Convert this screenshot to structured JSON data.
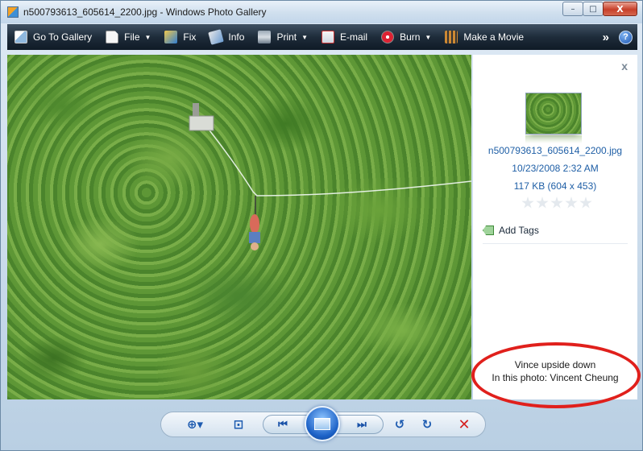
{
  "window": {
    "title": "n500793613_605614_2200.jpg - Windows Photo Gallery",
    "minimize": "–",
    "maximize": "□",
    "close": "X"
  },
  "toolbar": {
    "items": [
      {
        "label": "Go To Gallery",
        "icon": "gallery-icon"
      },
      {
        "label": "File",
        "icon": "file-icon",
        "dropdown": true
      },
      {
        "label": "Fix",
        "icon": "fix-icon"
      },
      {
        "label": "Info",
        "icon": "info-icon"
      },
      {
        "label": "Print",
        "icon": "print-icon",
        "dropdown": true
      },
      {
        "label": "E-mail",
        "icon": "email-icon"
      },
      {
        "label": "Burn",
        "icon": "burn-icon",
        "dropdown": true
      },
      {
        "label": "Make a Movie",
        "icon": "movie-icon"
      }
    ],
    "overflow": "»",
    "help": "?"
  },
  "info_pane": {
    "close": "x",
    "file_name": "n500793613_605614_2200.jpg",
    "date": "10/23/2008   2:32 AM",
    "size": "117 KB (604 x 453)",
    "rating": 0,
    "add_tags": "Add Tags",
    "caption_line1": "Vince upside down",
    "caption_line2": "In this photo: Vincent Cheung"
  },
  "controls": {
    "zoom": "⊕▾",
    "fit": "⊡",
    "prev": "⏮",
    "next": "⏭",
    "rotate_ccw": "↺",
    "rotate_cw": "↻",
    "delete": "✕"
  },
  "colors": {
    "toolbar_bg": "#1e2c3a",
    "link_blue": "#1f5fa6",
    "annotation_red": "#e0201c"
  }
}
